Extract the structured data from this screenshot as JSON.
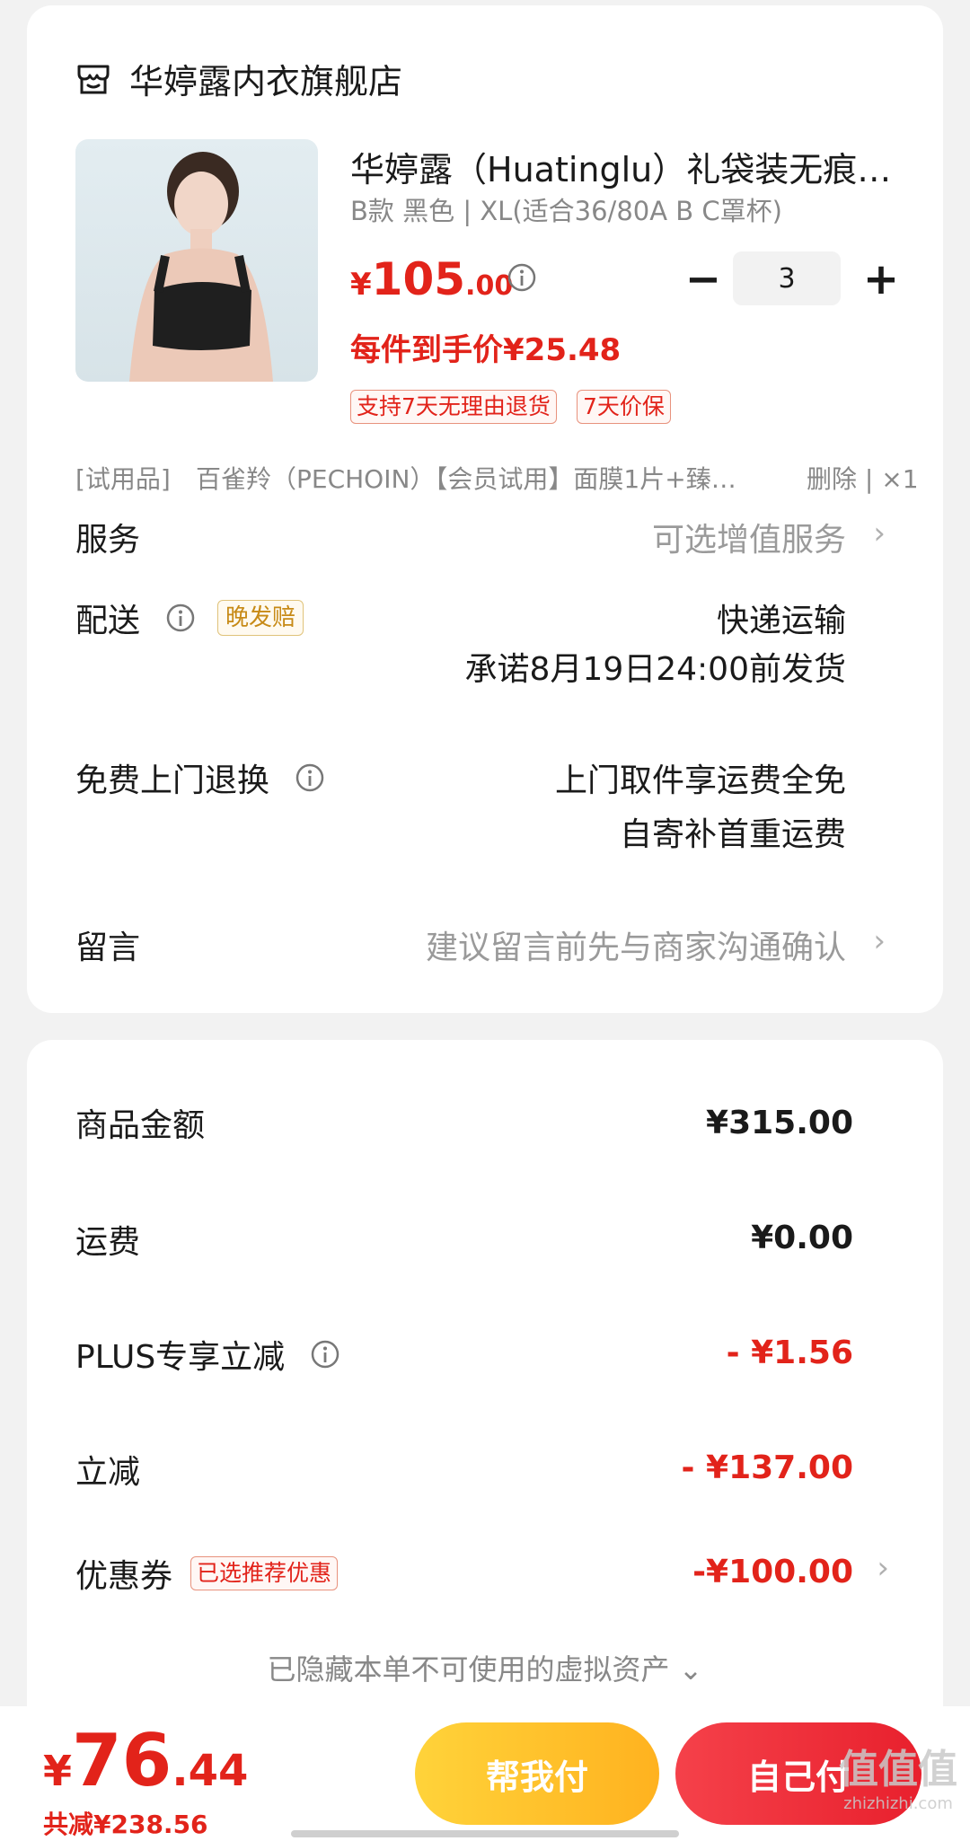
{
  "store": {
    "name": "华婷露内衣旗舰店",
    "icon": "store-icon"
  },
  "product": {
    "title": "华婷露（Huatinglu）礼袋装无痕…",
    "spec": "B款 黑色 | XL(适合36/80A B C罩杯)",
    "price_symbol": "¥",
    "price_int": "105",
    "price_dec": ".00",
    "quantity": "3",
    "minus_label": "−",
    "plus_label": "+",
    "unit_price": "每件到手价¥25.48",
    "tags": [
      "支持7天无理由退货",
      "7天价保"
    ]
  },
  "trial": {
    "tag": "[试用品]",
    "name": "百雀羚（PECHOIN）【会员试用】面膜1片+臻…",
    "action": "删除 | ×1"
  },
  "service": {
    "label": "服务",
    "value": "可选增值服务"
  },
  "delivery": {
    "label": "配送",
    "tag": "晚发赔",
    "method": "快递运输",
    "promise": "承诺8月19日24:00前发货"
  },
  "return": {
    "label": "免费上门退换",
    "line1": "上门取件享运费全免",
    "line2": "自寄补首重运费"
  },
  "message": {
    "label": "留言",
    "placeholder": "建议留言前先与商家沟通确认"
  },
  "summary": {
    "goods_label": "商品金额",
    "goods_value": "¥315.00",
    "shipping_label": "运费",
    "shipping_value": "¥0.00",
    "plus_label": "PLUS专享立减",
    "plus_value": "- ¥1.56",
    "discount_label": "立减",
    "discount_value": "- ¥137.00",
    "coupon_label": "优惠券",
    "coupon_tag": "已选推荐优惠",
    "coupon_value": "-¥100.00",
    "hidden_assets": "已隐藏本单不可使用的虚拟资产 ⌄"
  },
  "bottom": {
    "total_symbol": "¥",
    "total_int": "76",
    "total_dec": ".44",
    "saved": "共减¥238.56",
    "help_pay": "帮我付",
    "self_pay": "自己付",
    "watermark": "值值值",
    "watermark_sub": "zhizhizhi.com"
  },
  "colors": {
    "accent_red": "#e2231a",
    "help_yellow": "#ffc52a",
    "self_red": "#ee2d37"
  }
}
